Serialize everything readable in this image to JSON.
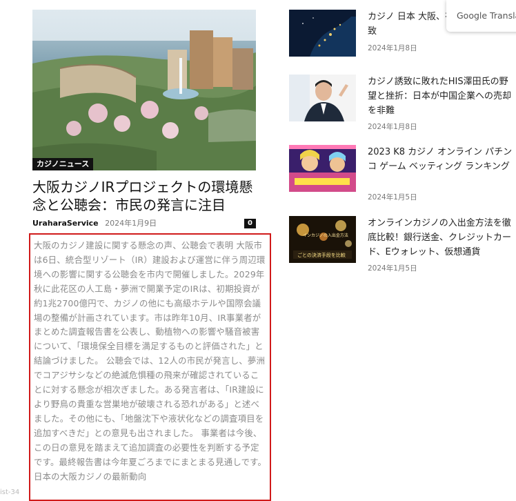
{
  "feature": {
    "category": "カジノニュース",
    "title": "大阪カジノIRプロジェクトの環境懸念と公聴会：市民の発言に注目",
    "author": "UraharaService",
    "date": "2024年1月9日",
    "comments": "0",
    "excerpt": "大阪のカジノ建設に関する懸念の声、公聴会で表明 大阪市は6日、統合型リゾート（IR）建設および運営に伴う周辺環境への影響に関する公聴会を市内で開催しました。2029年秋に此花区の人工島・夢洲で開業予定のIRは、初期投資が約1兆2700億円で、カジノの他にも高級ホテルや国際会議場の整備が計画されています。市は昨年10月、IR事業者がまとめた調査報告書を公表し、動植物への影響や騒音被害について、「環境保全目標を満足するものと評価された」と結論づけました。 公聴会では、12人の市民が発言し、夢洲でコアジサシなどの絶滅危惧種の飛来が確認されていることに対する懸念が相次ぎました。ある発言者は、「IR建設により野鳥の貴重な営巣地が破壊される恐れがある」と述べました。その他にも、「地盤沈下や液状化などの調査項目を追加すべきだ」との意見も出されました。 事業者は今後、この日の意見を踏まえて追加調査の必要性を判断する予定です。最終報告書は今年夏ごろまでにまとまる見通しです。 日本の大阪カジノの最新動向"
  },
  "edge_hint": "ist-34",
  "posts": [
    {
      "title": "カジノ 日本 大阪、有力候補！IR誘致",
      "date": "2024年1月8日"
    },
    {
      "title": "カジノ誘致に敗れたHIS澤田氏の野望と挫折：日本が中国企業への売却を非難",
      "date": "2024年1月8日"
    },
    {
      "title": "2023 K8 カジノ オンライン パチンコ ゲーム ベッティング ランキング",
      "date": "2024年1月5日"
    },
    {
      "title": "オンラインカジノの入出金方法を徹底比較！銀行送金、クレジットカード、Eウォレット、仮想通貨",
      "date": "2024年1月5日"
    }
  ],
  "thumb4_caption": "ごとの決済手段を比較",
  "thumb4_caption_top": "インカジノの入出金方法",
  "google_translate": "Google Translate",
  "colors": {
    "highlight_border": "#d01a1a",
    "excerpt_text": "#8a8a8a",
    "badge_bg": "#111111"
  },
  "icons": [
    "google-translate-logo"
  ]
}
